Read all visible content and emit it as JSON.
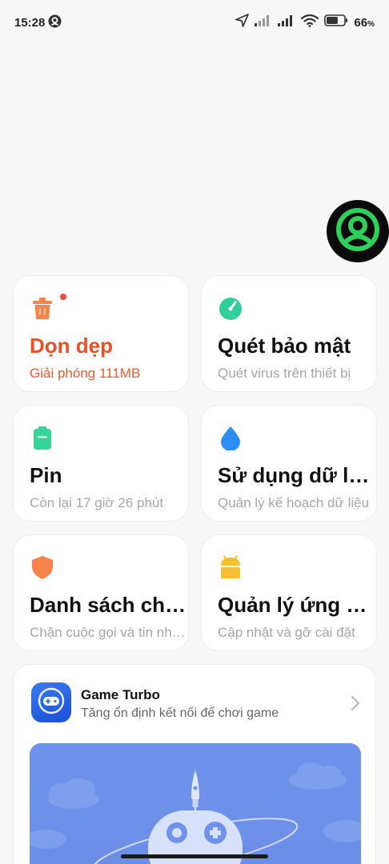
{
  "status_bar": {
    "time": "15:28",
    "battery_percent": "66",
    "battery_unit": "%",
    "battery_level": 0.66,
    "icons": [
      "location-app-icon",
      "navigation-icon",
      "signal-icon",
      "signal-icon",
      "wifi-icon",
      "battery-icon"
    ]
  },
  "tiles": [
    {
      "id": "cleanup",
      "title": "Dọn dẹp",
      "subtitle": "Giải phóng 111MB",
      "icon": "trash-icon",
      "icon_color": "#f7834b",
      "accent": "#ee4e22",
      "badge": true
    },
    {
      "id": "security-scan",
      "title": "Quét bảo mật",
      "subtitle": "Quét virus trên thiết bị",
      "icon": "speedometer-icon",
      "icon_color": "#2ecf98"
    },
    {
      "id": "battery",
      "title": "Pin",
      "subtitle": "Còn lại 17 giờ 26 phút",
      "icon": "battery-icon",
      "icon_color": "#34d49a"
    },
    {
      "id": "data-usage",
      "title": "Sử dụng dữ liệu",
      "subtitle": "Quản lý kế hoạch dữ liệu",
      "icon": "water-drop-icon",
      "icon_color": "#2a8ef2"
    },
    {
      "id": "blocklist",
      "title": "Danh sách chặn",
      "subtitle": "Chặn cuộc gọi và tin nhắn",
      "icon": "shield-icon",
      "icon_color": "#f7834b"
    },
    {
      "id": "manage-apps",
      "title": "Quản lý ứng dụng",
      "subtitle": "Cập nhật và gỡ cài đặt",
      "icon": "android-icon",
      "icon_color": "#f7bf2c"
    }
  ],
  "game_turbo": {
    "title": "Game Turbo",
    "subtitle": "Tăng ổn định kết nối để chơi game",
    "icon": "gamepad-icon",
    "brand_color": "#2f6ef0",
    "banner_color": "#6f93ec"
  }
}
